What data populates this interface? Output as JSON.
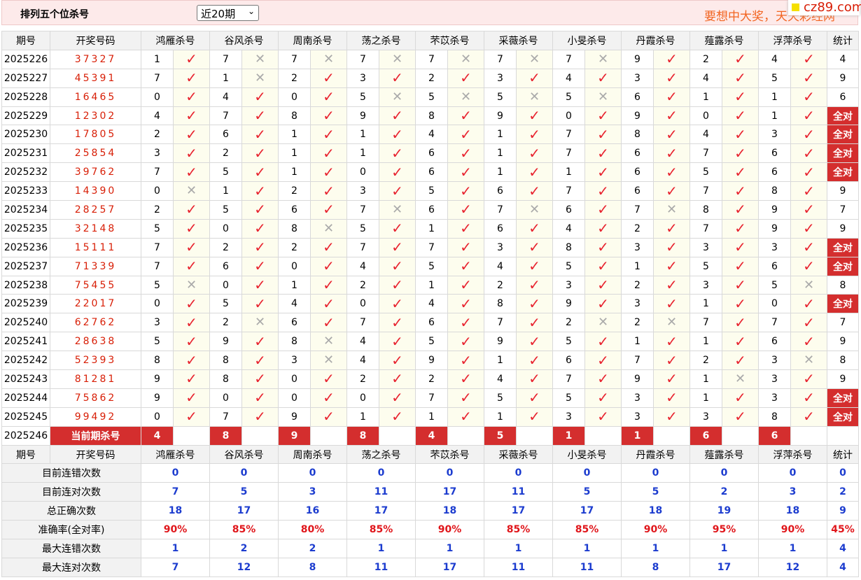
{
  "header": {
    "title": "排列五个位杀号",
    "period_select": "近20期",
    "slogan": "要想中大奖，天天彩经网",
    "watermark": "cz89.com"
  },
  "columns": {
    "period": "期号",
    "draw": "开奖号码",
    "experts": [
      "鸿雁杀号",
      "谷风杀号",
      "周南杀号",
      "荡之杀号",
      "芣苡杀号",
      "采薇杀号",
      "小旻杀号",
      "丹霞杀号",
      "薤露杀号",
      "浮萍杀号"
    ],
    "stats": "统计"
  },
  "rows": [
    {
      "period": "2025226",
      "draw": "37327",
      "kills": [
        1,
        7,
        7,
        7,
        7,
        7,
        7,
        9,
        2,
        4
      ],
      "hits": [
        1,
        0,
        0,
        0,
        0,
        0,
        0,
        1,
        1,
        1
      ],
      "stat": "4"
    },
    {
      "period": "2025227",
      "draw": "45391",
      "kills": [
        7,
        1,
        2,
        3,
        2,
        3,
        4,
        3,
        4,
        5
      ],
      "hits": [
        1,
        0,
        1,
        1,
        1,
        1,
        1,
        1,
        1,
        1
      ],
      "stat": "9"
    },
    {
      "period": "2025228",
      "draw": "16465",
      "kills": [
        0,
        4,
        0,
        5,
        5,
        5,
        5,
        6,
        1,
        1
      ],
      "hits": [
        1,
        1,
        1,
        0,
        0,
        0,
        0,
        1,
        1,
        1
      ],
      "stat": "6"
    },
    {
      "period": "2025229",
      "draw": "12302",
      "kills": [
        4,
        7,
        8,
        9,
        8,
        9,
        0,
        9,
        0,
        1
      ],
      "hits": [
        1,
        1,
        1,
        1,
        1,
        1,
        1,
        1,
        1,
        1
      ],
      "stat": "全对"
    },
    {
      "period": "2025230",
      "draw": "17805",
      "kills": [
        2,
        6,
        1,
        1,
        4,
        1,
        7,
        8,
        4,
        3
      ],
      "hits": [
        1,
        1,
        1,
        1,
        1,
        1,
        1,
        1,
        1,
        1
      ],
      "stat": "全对"
    },
    {
      "period": "2025231",
      "draw": "25854",
      "kills": [
        3,
        2,
        1,
        1,
        6,
        1,
        7,
        6,
        7,
        6
      ],
      "hits": [
        1,
        1,
        1,
        1,
        1,
        1,
        1,
        1,
        1,
        1
      ],
      "stat": "全对"
    },
    {
      "period": "2025232",
      "draw": "39762",
      "kills": [
        7,
        5,
        1,
        0,
        6,
        1,
        1,
        6,
        5,
        6
      ],
      "hits": [
        1,
        1,
        1,
        1,
        1,
        1,
        1,
        1,
        1,
        1
      ],
      "stat": "全对"
    },
    {
      "period": "2025233",
      "draw": "14390",
      "kills": [
        0,
        1,
        2,
        3,
        5,
        6,
        7,
        6,
        7,
        8
      ],
      "hits": [
        0,
        1,
        1,
        1,
        1,
        1,
        1,
        1,
        1,
        1
      ],
      "stat": "9"
    },
    {
      "period": "2025234",
      "draw": "28257",
      "kills": [
        2,
        5,
        6,
        7,
        6,
        7,
        6,
        7,
        8,
        9
      ],
      "hits": [
        1,
        1,
        1,
        0,
        1,
        0,
        1,
        0,
        1,
        1
      ],
      "stat": "7"
    },
    {
      "period": "2025235",
      "draw": "32148",
      "kills": [
        5,
        0,
        8,
        5,
        1,
        6,
        4,
        2,
        7,
        9
      ],
      "hits": [
        1,
        1,
        0,
        1,
        1,
        1,
        1,
        1,
        1,
        1
      ],
      "stat": "9"
    },
    {
      "period": "2025236",
      "draw": "15111",
      "kills": [
        7,
        2,
        2,
        7,
        7,
        3,
        8,
        3,
        3,
        3
      ],
      "hits": [
        1,
        1,
        1,
        1,
        1,
        1,
        1,
        1,
        1,
        1
      ],
      "stat": "全对"
    },
    {
      "period": "2025237",
      "draw": "71339",
      "kills": [
        7,
        6,
        0,
        4,
        5,
        4,
        5,
        1,
        5,
        6
      ],
      "hits": [
        1,
        1,
        1,
        1,
        1,
        1,
        1,
        1,
        1,
        1
      ],
      "stat": "全对"
    },
    {
      "period": "2025238",
      "draw": "75455",
      "kills": [
        5,
        0,
        1,
        2,
        1,
        2,
        3,
        2,
        3,
        5
      ],
      "hits": [
        0,
        1,
        1,
        1,
        1,
        1,
        1,
        1,
        1,
        0
      ],
      "stat": "8"
    },
    {
      "period": "2025239",
      "draw": "22017",
      "kills": [
        0,
        5,
        4,
        0,
        4,
        8,
        9,
        3,
        1,
        0
      ],
      "hits": [
        1,
        1,
        1,
        1,
        1,
        1,
        1,
        1,
        1,
        1
      ],
      "stat": "全对"
    },
    {
      "period": "2025240",
      "draw": "62762",
      "kills": [
        3,
        2,
        6,
        7,
        6,
        7,
        2,
        2,
        7,
        7
      ],
      "hits": [
        1,
        0,
        1,
        1,
        1,
        1,
        0,
        0,
        1,
        1
      ],
      "stat": "7"
    },
    {
      "period": "2025241",
      "draw": "28638",
      "kills": [
        5,
        9,
        8,
        4,
        5,
        9,
        5,
        1,
        1,
        6
      ],
      "hits": [
        1,
        1,
        0,
        1,
        1,
        1,
        1,
        1,
        1,
        1
      ],
      "stat": "9"
    },
    {
      "period": "2025242",
      "draw": "52393",
      "kills": [
        8,
        8,
        3,
        4,
        9,
        1,
        6,
        7,
        2,
        3
      ],
      "hits": [
        1,
        1,
        0,
        1,
        1,
        1,
        1,
        1,
        1,
        0
      ],
      "stat": "8"
    },
    {
      "period": "2025243",
      "draw": "81281",
      "kills": [
        9,
        8,
        0,
        2,
        2,
        4,
        7,
        9,
        1,
        3
      ],
      "hits": [
        1,
        1,
        1,
        1,
        1,
        1,
        1,
        1,
        0,
        1
      ],
      "stat": "9"
    },
    {
      "period": "2025244",
      "draw": "75862",
      "kills": [
        9,
        0,
        0,
        0,
        7,
        5,
        5,
        3,
        1,
        3
      ],
      "hits": [
        1,
        1,
        1,
        1,
        1,
        1,
        1,
        1,
        1,
        1
      ],
      "stat": "全对"
    },
    {
      "period": "2025245",
      "draw": "99492",
      "kills": [
        0,
        7,
        9,
        1,
        1,
        1,
        3,
        3,
        3,
        8
      ],
      "hits": [
        1,
        1,
        1,
        1,
        1,
        1,
        1,
        1,
        1,
        1
      ],
      "stat": "全对"
    }
  ],
  "current": {
    "period": "2025246",
    "label": "当前期杀号",
    "kills": [
      4,
      8,
      9,
      8,
      4,
      5,
      1,
      1,
      6,
      6
    ]
  },
  "summary": [
    {
      "label": "目前连错次数",
      "values": [
        "0",
        "0",
        "0",
        "0",
        "0",
        "0",
        "0",
        "0",
        "0",
        "0"
      ],
      "stat": "0",
      "kind": "val"
    },
    {
      "label": "目前连对次数",
      "values": [
        "7",
        "5",
        "3",
        "11",
        "17",
        "11",
        "5",
        "5",
        "2",
        "3"
      ],
      "stat": "2",
      "kind": "val"
    },
    {
      "label": "总正确次数",
      "values": [
        "18",
        "17",
        "16",
        "17",
        "18",
        "17",
        "17",
        "18",
        "19",
        "18"
      ],
      "stat": "9",
      "kind": "val"
    },
    {
      "label": "准确率(全对率)",
      "values": [
        "90%",
        "85%",
        "80%",
        "85%",
        "90%",
        "85%",
        "85%",
        "90%",
        "95%",
        "90%"
      ],
      "stat": "45%",
      "kind": "rate"
    },
    {
      "label": "最大连错次数",
      "values": [
        "1",
        "2",
        "2",
        "1",
        "1",
        "1",
        "1",
        "1",
        "1",
        "1"
      ],
      "stat": "4",
      "kind": "val"
    },
    {
      "label": "最大连对次数",
      "values": [
        "7",
        "12",
        "8",
        "11",
        "17",
        "11",
        "11",
        "8",
        "17",
        "12"
      ],
      "stat": "4",
      "kind": "val"
    }
  ],
  "icons": {
    "hit": "check-icon",
    "miss": "cross-icon"
  },
  "colors": {
    "accent_red": "#d42e2e",
    "check_red": "#e8232f",
    "stat_blue": "#1c3ccf",
    "slogan_orange": "#f26522",
    "header_bg": "#fdeaea"
  }
}
